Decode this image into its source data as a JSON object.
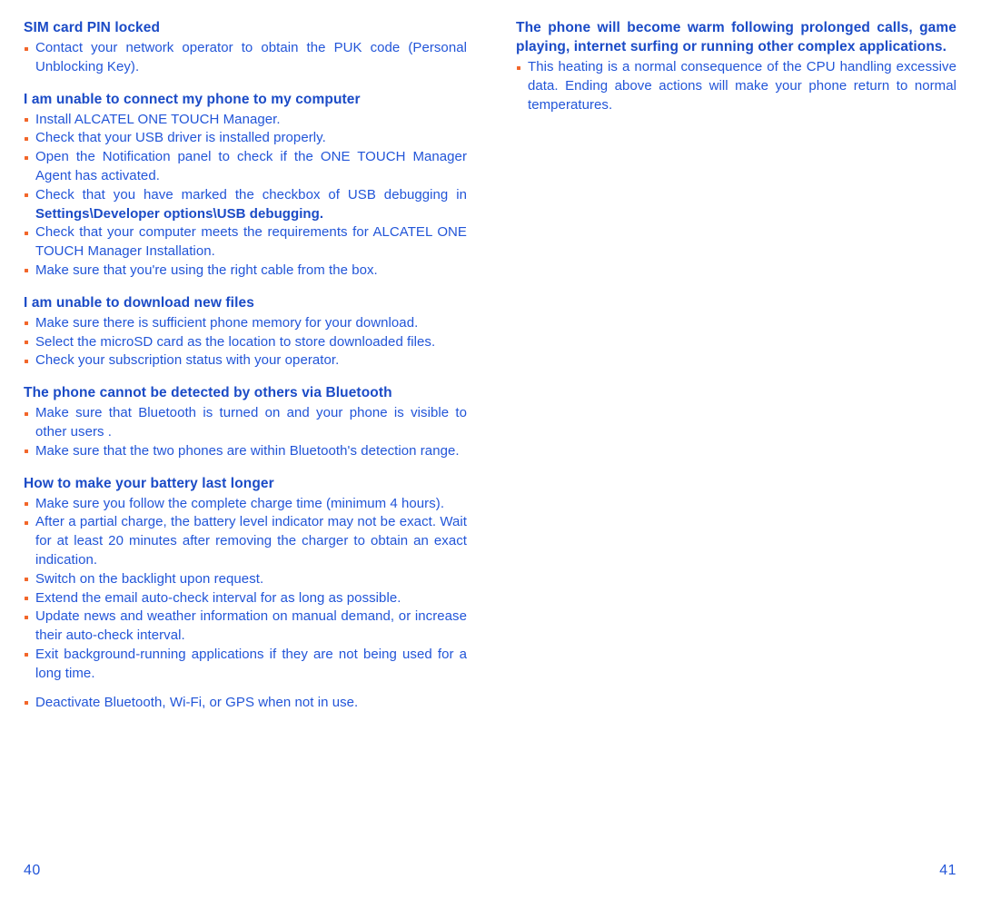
{
  "colors": {
    "heading_blue": "#1B4BC6",
    "body_blue": "#2255D8",
    "bullet_orange": "#F2662A",
    "page_background": "#FFFFFF"
  },
  "left_page": {
    "folio": "40",
    "sections": [
      {
        "heading": "SIM card PIN locked",
        "bullets": [
          {
            "text": "Contact your network operator to obtain the PUK code (Personal Unblocking Key)."
          }
        ]
      },
      {
        "heading": "I am unable to connect my phone to my computer",
        "bullets": [
          {
            "text": "Install ALCATEL ONE TOUCH Manager."
          },
          {
            "text": "Check that your USB driver is installed properly."
          },
          {
            "text": "Open the Notification panel to check if the ONE TOUCH Manager Agent has activated."
          },
          {
            "text": "Check that you have marked the checkbox of USB debugging in ",
            "bold_tail": "Settings\\Developer options\\USB debugging."
          },
          {
            "text": "Check that your computer meets the requirements for ALCATEL ONE TOUCH Manager Installation."
          },
          {
            "text": "Make sure that you're using the right cable from the box."
          }
        ]
      },
      {
        "heading": "I am unable to download new files",
        "bullets": [
          {
            "text": "Make sure there is sufficient phone memory for your download."
          },
          {
            "text": "Select the microSD card as the location to store downloaded files."
          },
          {
            "text": "Check your subscription status with your operator."
          }
        ]
      },
      {
        "heading": "The phone cannot be detected by others via Bluetooth",
        "bullets": [
          {
            "text": "Make sure that Bluetooth is turned on and your phone is visible to other users ."
          },
          {
            "text": "Make sure that the two phones are within Bluetooth's detection range."
          }
        ]
      },
      {
        "heading": "How to make your battery last longer",
        "bullets": [
          {
            "text": "Make sure you follow the complete charge time (minimum 4 hours)."
          },
          {
            "text": "After a partial charge, the battery level indicator may not be exact. Wait for at least 20 minutes after removing the charger to obtain an exact indication."
          },
          {
            "text": "Switch on the backlight upon request."
          },
          {
            "text": "Extend the email auto-check interval for as long as possible."
          },
          {
            "text": "Update news and weather information on manual demand, or increase their auto-check interval."
          },
          {
            "text": "Exit background-running applications if they are not being used for a long time."
          },
          {
            "text": "Deactivate Bluetooth, Wi-Fi, or GPS when not in use.",
            "gap_before": true
          }
        ]
      }
    ]
  },
  "right_page": {
    "folio": "41",
    "sections": [
      {
        "heading": "The phone will become warm following prolonged calls, game playing, internet surfing or running other complex applications.",
        "bullets": [
          {
            "text": "This heating is a normal consequence of the CPU handling excessive data. Ending above actions will make your phone return to normal temperatures."
          }
        ]
      }
    ]
  }
}
